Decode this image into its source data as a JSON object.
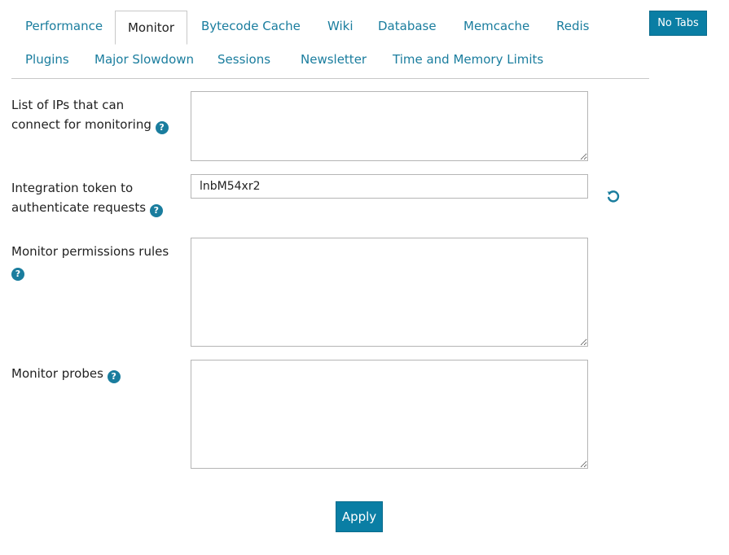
{
  "top_button": {
    "label": "No Tabs"
  },
  "tabs": [
    {
      "label": "Performance"
    },
    {
      "label": "Monitor",
      "active": true
    },
    {
      "label": "Bytecode Cache"
    },
    {
      "label": "Wiki"
    },
    {
      "label": "Database"
    },
    {
      "label": "Memcache"
    },
    {
      "label": "Redis"
    },
    {
      "label": "Plugins"
    },
    {
      "label": "Major Slowdown"
    },
    {
      "label": "Sessions"
    },
    {
      "label": "Newsletter"
    },
    {
      "label": "Time and Memory Limits"
    }
  ],
  "form": {
    "ips": {
      "label_line1": "List of IPs that can",
      "label_line2": "connect for monitoring",
      "value": ""
    },
    "token": {
      "label_line1": "Integration token to",
      "label_line2": "authenticate requests",
      "value": "lnbM54xr2"
    },
    "permissions": {
      "label": "Monitor permissions rules",
      "value": ""
    },
    "probes": {
      "label": "Monitor probes",
      "value": ""
    },
    "help_glyph": "?",
    "apply_label": "Apply"
  },
  "icons": {
    "help": "help-icon",
    "refresh": "refresh-icon"
  },
  "colors": {
    "accent": "#0a7ea4",
    "link": "#1a7d9e"
  }
}
